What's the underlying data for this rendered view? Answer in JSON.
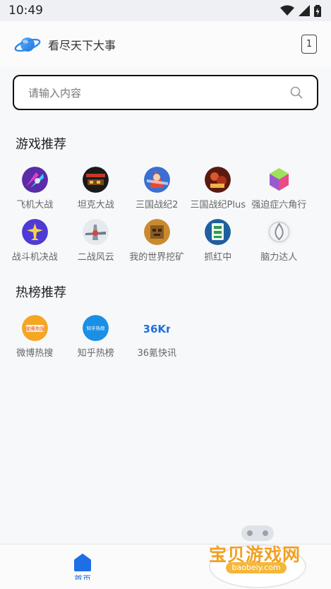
{
  "status_bar": {
    "time": "10:49"
  },
  "header": {
    "title": "看尽天下大事",
    "tab_count": "1"
  },
  "search": {
    "placeholder": "请输入内容"
  },
  "games_section": {
    "title": "游戏推荐",
    "items": [
      {
        "label": "飞机大战"
      },
      {
        "label": "坦克大战"
      },
      {
        "label": "三国战纪2"
      },
      {
        "label": "三国战纪Plus"
      },
      {
        "label": "强迫症六角行"
      },
      {
        "label": "战斗机决战"
      },
      {
        "label": "二战风云"
      },
      {
        "label": "我的世界挖矿"
      },
      {
        "label": "抓红中"
      },
      {
        "label": "脑力达人"
      }
    ]
  },
  "hot_section": {
    "title": "热榜推荐",
    "items": [
      {
        "label": "微博热搜",
        "icon_text": "微博热搜"
      },
      {
        "label": "知乎热榜",
        "icon_text": "知乎热榜"
      },
      {
        "label": "36氪快讯",
        "icon_text": "36Kr"
      }
    ]
  },
  "bottom_nav": {
    "home_label": "首页"
  },
  "watermark": {
    "text": "宝贝游戏网",
    "url": "baobeiy.com"
  }
}
